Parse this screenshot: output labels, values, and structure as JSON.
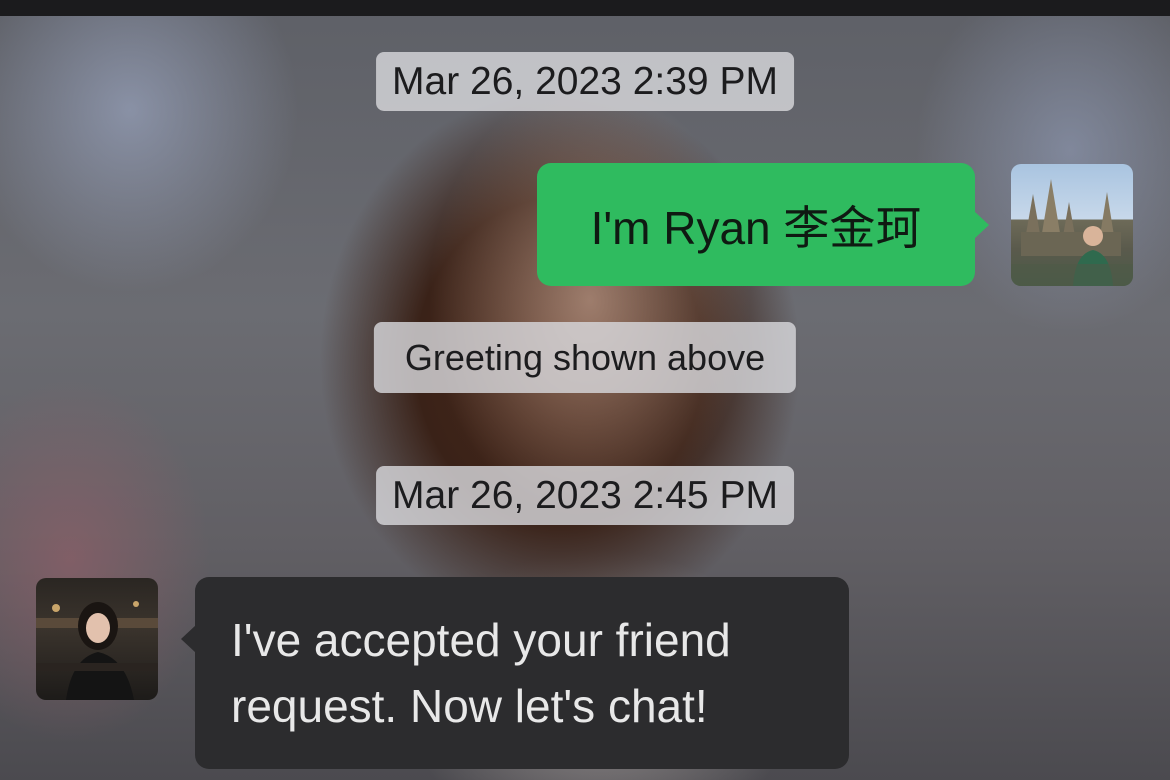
{
  "chat": {
    "messages": [
      {
        "type": "timestamp",
        "text": "Mar 26, 2023 2:39 PM"
      },
      {
        "type": "outgoing",
        "text": "I'm Ryan 李金珂"
      },
      {
        "type": "system",
        "text": "Greeting shown above"
      },
      {
        "type": "timestamp",
        "text": "Mar 26, 2023 2:45 PM"
      },
      {
        "type": "incoming",
        "lines": [
          "I've accepted your friend",
          "request. Now let's chat!"
        ]
      }
    ]
  },
  "colors": {
    "outgoing_bubble": "#2fbb5f",
    "incoming_bubble": "#2c2c2e",
    "timestamp_bg": "#d7d7da"
  }
}
